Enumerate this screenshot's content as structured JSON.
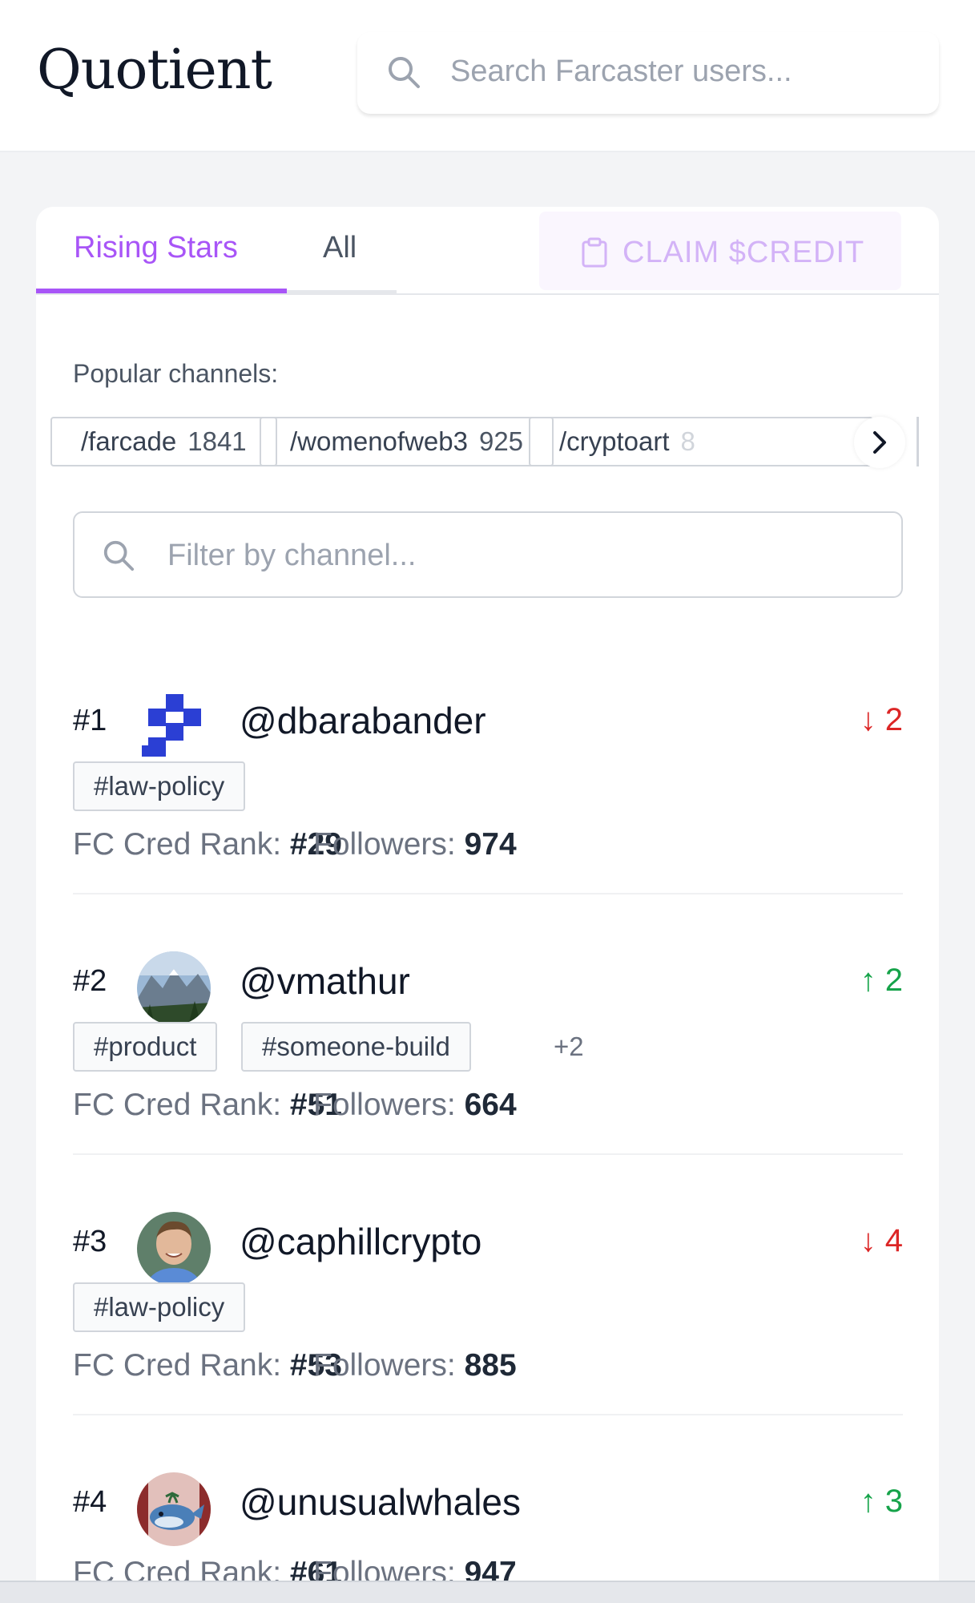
{
  "header": {
    "logo": "Quotient",
    "search_placeholder": "Search Farcaster users..."
  },
  "tabs": {
    "rising": "Rising Stars",
    "all": "All",
    "claim": "CLAIM $CREDIT"
  },
  "channels": {
    "label": "Popular channels:",
    "items": [
      {
        "name": "/farcade",
        "count": "1841"
      },
      {
        "name": "/womenofweb3",
        "count": "925"
      },
      {
        "name": "/cryptoart",
        "count": "8"
      }
    ]
  },
  "filter": {
    "placeholder": "Filter by channel..."
  },
  "users": [
    {
      "rank": "#1",
      "handle": "@dbarabander",
      "direction": "down",
      "arrow": "↓",
      "delta": "2",
      "tags": [
        "#law-policy"
      ],
      "more": "",
      "cred_label": "FC Cred Rank:",
      "cred": "#29",
      "followers_label": "Followers:",
      "followers": "974"
    },
    {
      "rank": "#2",
      "handle": "@vmathur",
      "direction": "up",
      "arrow": "↑",
      "delta": "2",
      "tags": [
        "#product",
        "#someone-build"
      ],
      "more": "+2",
      "cred_label": "FC Cred Rank:",
      "cred": "#51",
      "followers_label": "Followers:",
      "followers": "664"
    },
    {
      "rank": "#3",
      "handle": "@caphillcrypto",
      "direction": "down",
      "arrow": "↓",
      "delta": "4",
      "tags": [
        "#law-policy"
      ],
      "more": "",
      "cred_label": "FC Cred Rank:",
      "cred": "#53",
      "followers_label": "Followers:",
      "followers": "885"
    },
    {
      "rank": "#4",
      "handle": "@unusualwhales",
      "direction": "up",
      "arrow": "↑",
      "delta": "3",
      "tags": [],
      "more": "",
      "cred_label": "FC Cred Rank:",
      "cred": "#61",
      "followers_label": "Followers:",
      "followers": "947"
    }
  ],
  "colors": {
    "accent": "#a855f7",
    "down": "#dc2626",
    "up": "#16a34a",
    "dbarabander_logo": "#2b3fd4"
  }
}
